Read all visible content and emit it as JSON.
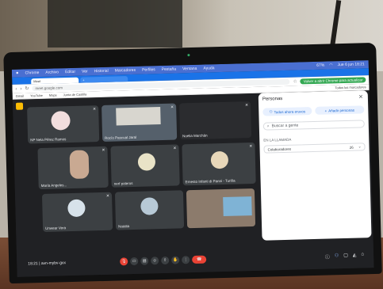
{
  "menubar": {
    "items": [
      "Chrome",
      "Archivo",
      "Editar",
      "Ver",
      "Historial",
      "Marcadores",
      "Perfiles",
      "Pestaña",
      "Ventana",
      "Ayuda"
    ],
    "battery": "67%",
    "clock": "Jue 6 jun 18:21"
  },
  "browser": {
    "tab_label": "Meet",
    "url": "meet.google.com",
    "close_chrome_label": "Volver a abrir Chrome para actualizar",
    "bookmarks": [
      "Gmail",
      "YouTube",
      "Maps",
      "Junta de Castilla"
    ],
    "all_bookmarks": "Todos los marcadores"
  },
  "participants": [
    {
      "name": "NP Nela Pérez Ramos"
    },
    {
      "name": "Rocío Pascual Jaral"
    },
    {
      "name": "Noelia Marchán"
    },
    {
      "name": "María Angeles..."
    },
    {
      "name": "nerf paleros"
    },
    {
      "name": "Ernesto Infanti di Panni - Turiña"
    },
    {
      "name": "Unwear Vera"
    },
    {
      "name": "Natalia"
    },
    {
      "name": ""
    }
  ],
  "people_panel": {
    "title": "Personas",
    "add_button": "Añadir personas",
    "all_button": "Todos ahora eruvos",
    "search_placeholder": "Buscar a gente",
    "in_call_label": "EN LA LLAMADA",
    "contributors_label": "Colaboradores",
    "contributors_count": "26"
  },
  "controls": {
    "meeting_info": "18:21 | avn-mybv-gxx"
  }
}
